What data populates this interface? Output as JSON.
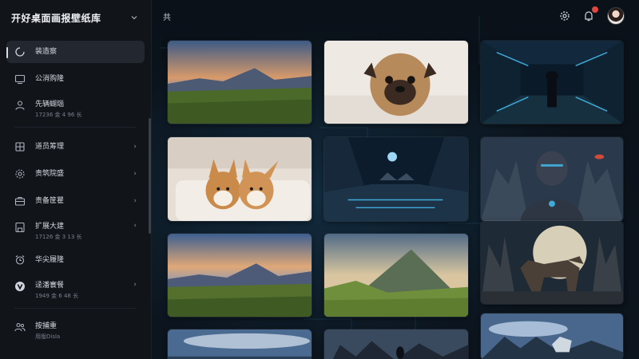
{
  "app": {
    "title": "开好桌面画报壁纸库"
  },
  "nav": {
    "items": [
      {
        "label": "装造察",
        "sub": ""
      },
      {
        "label": "公消购隆",
        "sub": ""
      },
      {
        "label": "先辆蝴瑙",
        "sub": "17236 金 4 96 长"
      },
      {
        "label": "道员筹理",
        "sub": ""
      },
      {
        "label": "责筑院盛",
        "sub": ""
      },
      {
        "label": "责备筐瞿",
        "sub": ""
      },
      {
        "label": "扩展大建",
        "sub": "17126 金 3 13 长"
      },
      {
        "label": "华尖履隆",
        "sub": ""
      },
      {
        "label": "迳潘寰餐",
        "sub": "1949 金 6 48 长"
      },
      {
        "label": "按捕重",
        "sub": "用版Disla"
      }
    ]
  },
  "topbar": {
    "crumb": "共"
  },
  "colors": {
    "accent": "#3fa9d8",
    "badge": "#e0463e"
  },
  "tiles": [
    {
      "subject": "mountain-sunset"
    },
    {
      "subject": "pug-dog"
    },
    {
      "subject": "scifi-corridor-figure"
    },
    {
      "subject": "corgi-puppies"
    },
    {
      "subject": "scifi-hangar-planet"
    },
    {
      "subject": "robot-portrait"
    },
    {
      "subject": "mountain-sunset-2"
    },
    {
      "subject": "green-mountain"
    },
    {
      "subject": "dog-moon"
    },
    {
      "subject": "sky-lake"
    },
    {
      "subject": "dark-rocks-figure"
    },
    {
      "subject": "cloud-dog"
    }
  ]
}
